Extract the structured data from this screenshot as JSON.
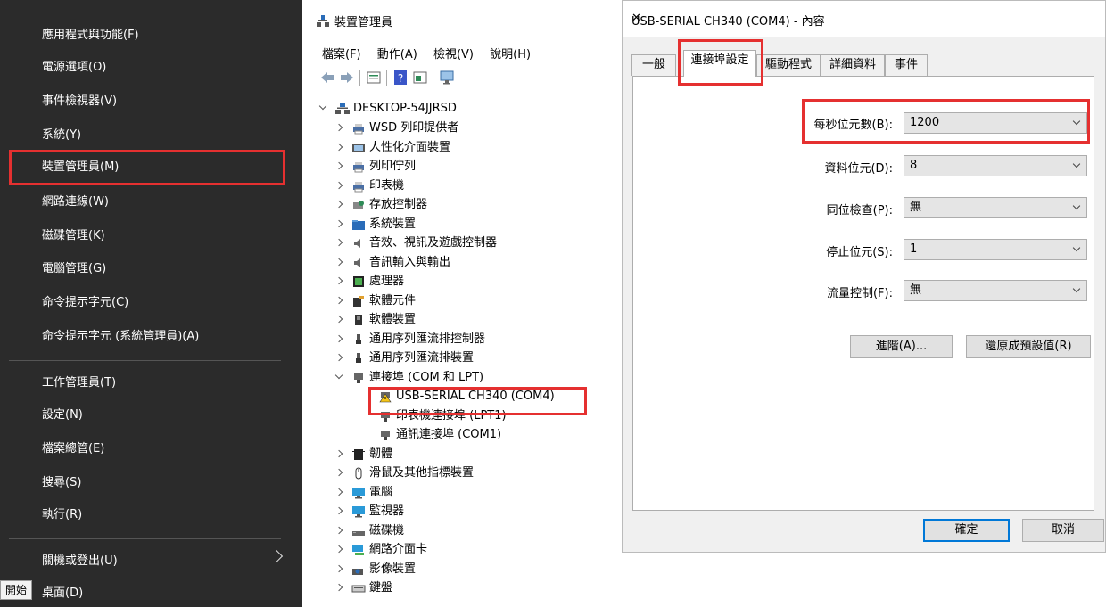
{
  "winx_menu": {
    "items": [
      {
        "label": "應用程式與功能(F)"
      },
      {
        "label": "電源選項(O)"
      },
      {
        "label": "事件檢視器(V)"
      },
      {
        "label": "系統(Y)"
      },
      {
        "label": "裝置管理員(M)"
      },
      {
        "label": "網路連線(W)"
      },
      {
        "label": "磁碟管理(K)"
      },
      {
        "label": "電腦管理(G)"
      },
      {
        "label": "命令提示字元(C)"
      },
      {
        "label": "命令提示字元 (系統管理員)(A)"
      },
      {
        "label": "工作管理員(T)"
      },
      {
        "label": "設定(N)"
      },
      {
        "label": "檔案總管(E)"
      },
      {
        "label": "搜尋(S)"
      },
      {
        "label": "執行(R)"
      },
      {
        "label": "關機或登出(U)"
      },
      {
        "label": "桌面(D)"
      }
    ],
    "start_tooltip": "開始"
  },
  "device_manager": {
    "title": "裝置管理員",
    "menu": [
      "檔案(F)",
      "動作(A)",
      "檢視(V)",
      "說明(H)"
    ],
    "root": "DESKTOP-54JJRSD",
    "tree": [
      {
        "label": "WSD 列印提供者",
        "icon": "printer-icon"
      },
      {
        "label": "人性化介面裝置",
        "icon": "hid-icon"
      },
      {
        "label": "列印佇列",
        "icon": "printer-icon"
      },
      {
        "label": "印表機",
        "icon": "printer-icon"
      },
      {
        "label": "存放控制器",
        "icon": "storage-icon"
      },
      {
        "label": "系統裝置",
        "icon": "folder-icon"
      },
      {
        "label": "音效、視訊及遊戲控制器",
        "icon": "speaker-icon"
      },
      {
        "label": "音訊輸入與輸出",
        "icon": "speaker-icon"
      },
      {
        "label": "處理器",
        "icon": "cpu-icon"
      },
      {
        "label": "軟體元件",
        "icon": "component-icon"
      },
      {
        "label": "軟體裝置",
        "icon": "device-icon"
      },
      {
        "label": "通用序列匯流排控制器",
        "icon": "usb-icon"
      },
      {
        "label": "通用序列匯流排裝置",
        "icon": "usb-icon"
      },
      {
        "label": "連接埠 (COM 和 LPT)",
        "icon": "port-icon"
      },
      {
        "label": "USB-SERIAL CH340 (COM4)",
        "icon": "warning-port-icon"
      },
      {
        "label": "印表機連接埠 (LPT1)",
        "icon": "port-icon"
      },
      {
        "label": "通訊連接埠 (COM1)",
        "icon": "port-icon"
      },
      {
        "label": "韌體",
        "icon": "firmware-icon"
      },
      {
        "label": "滑鼠及其他指標裝置",
        "icon": "mouse-icon"
      },
      {
        "label": "電腦",
        "icon": "monitor-icon"
      },
      {
        "label": "監視器",
        "icon": "monitor-icon"
      },
      {
        "label": "磁碟機",
        "icon": "disk-icon"
      },
      {
        "label": "網路介面卡",
        "icon": "network-icon"
      },
      {
        "label": "影像裝置",
        "icon": "camera-icon"
      },
      {
        "label": "鍵盤",
        "icon": "keyboard-icon"
      }
    ]
  },
  "properties_dialog": {
    "title": "USB-SERIAL CH340 (COM4) - 內容",
    "close": "✕",
    "tabs": [
      "一般",
      "連接埠設定",
      "驅動程式",
      "詳細資料",
      "事件"
    ],
    "fields": [
      {
        "label": "每秒位元數(B):",
        "value": "1200"
      },
      {
        "label": "資料位元(D):",
        "value": "8"
      },
      {
        "label": "同位檢查(P):",
        "value": "無"
      },
      {
        "label": "停止位元(S):",
        "value": "1"
      },
      {
        "label": "流量控制(F):",
        "value": "無"
      }
    ],
    "advanced_button": "進階(A)...",
    "restore_button": "還原成預設值(R)",
    "ok_button": "確定",
    "cancel_button": "取消"
  },
  "colors": {
    "highlight_box": "#e53030",
    "menu_bg": "#2b2b2b"
  }
}
